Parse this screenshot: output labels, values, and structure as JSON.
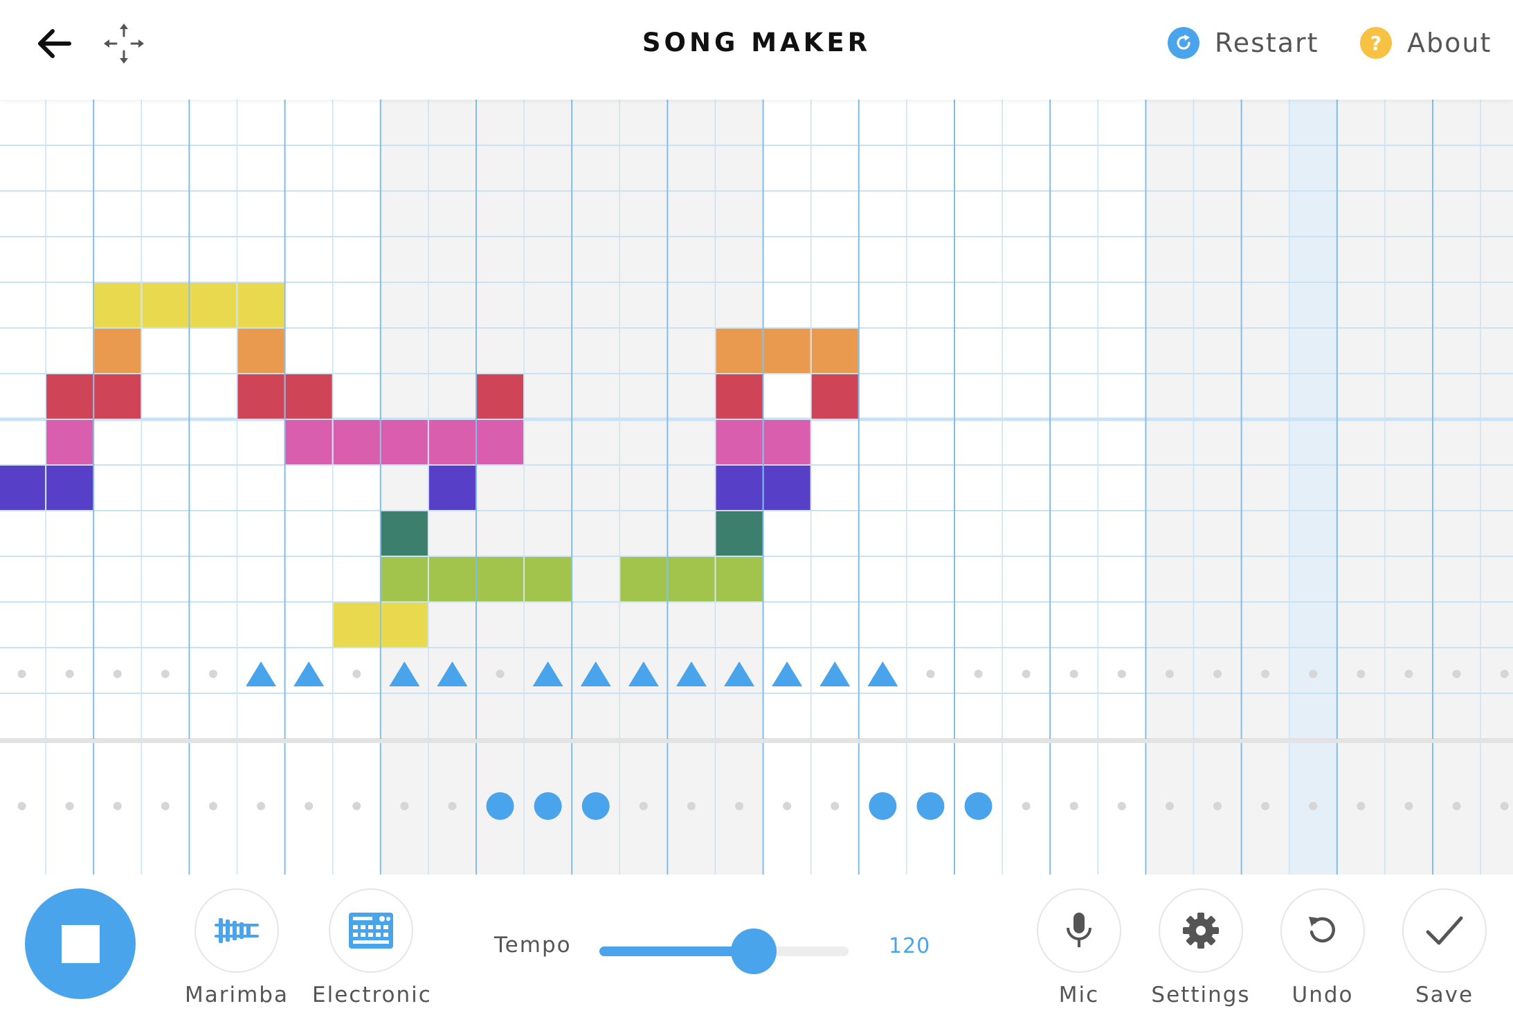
{
  "header": {
    "title": "SONG MAKER",
    "restart_label": "Restart",
    "about_label": "About",
    "back_icon": "arrow-left-icon",
    "move_icon": "move-arrows-icon",
    "restart_icon": "refresh-icon",
    "about_icon": "question-icon",
    "about_glyph": "?"
  },
  "colors": {
    "accent": "#4aa4eb",
    "restart_circle": "#4aa4eb",
    "about_circle": "#f7c244",
    "grid_line": "#c9e2f6",
    "bar_line": "#7fbdec",
    "shade": "#f3f3f3",
    "highlight_column": "#e4eff8",
    "note_palette": {
      "yellow": "#e8d94e",
      "orange": "#e99a4f",
      "red": "#d04458",
      "pink": "#d95fae",
      "purple": "#583fc7",
      "teal": "#3c7f6d",
      "green": "#a2c44c"
    }
  },
  "grid": {
    "columns": 32,
    "melody_rows": 14,
    "playhead_column": 27,
    "melody_notes": [
      {
        "col": 2,
        "row": 4,
        "color": "yellow"
      },
      {
        "col": 3,
        "row": 4,
        "color": "yellow"
      },
      {
        "col": 4,
        "row": 4,
        "color": "yellow"
      },
      {
        "col": 5,
        "row": 4,
        "color": "yellow"
      },
      {
        "col": 2,
        "row": 5,
        "color": "orange"
      },
      {
        "col": 5,
        "row": 5,
        "color": "orange"
      },
      {
        "col": 15,
        "row": 5,
        "color": "orange"
      },
      {
        "col": 16,
        "row": 5,
        "color": "orange"
      },
      {
        "col": 17,
        "row": 5,
        "color": "orange"
      },
      {
        "col": 1,
        "row": 6,
        "color": "red"
      },
      {
        "col": 2,
        "row": 6,
        "color": "red"
      },
      {
        "col": 5,
        "row": 6,
        "color": "red"
      },
      {
        "col": 6,
        "row": 6,
        "color": "red"
      },
      {
        "col": 10,
        "row": 6,
        "color": "red"
      },
      {
        "col": 15,
        "row": 6,
        "color": "red"
      },
      {
        "col": 17,
        "row": 6,
        "color": "red"
      },
      {
        "col": 1,
        "row": 7,
        "color": "pink"
      },
      {
        "col": 6,
        "row": 7,
        "color": "pink"
      },
      {
        "col": 7,
        "row": 7,
        "color": "pink"
      },
      {
        "col": 8,
        "row": 7,
        "color": "pink"
      },
      {
        "col": 9,
        "row": 7,
        "color": "pink"
      },
      {
        "col": 10,
        "row": 7,
        "color": "pink"
      },
      {
        "col": 15,
        "row": 7,
        "color": "pink"
      },
      {
        "col": 16,
        "row": 7,
        "color": "pink"
      },
      {
        "col": 0,
        "row": 8,
        "color": "purple"
      },
      {
        "col": 1,
        "row": 8,
        "color": "purple"
      },
      {
        "col": 9,
        "row": 8,
        "color": "purple"
      },
      {
        "col": 15,
        "row": 8,
        "color": "purple"
      },
      {
        "col": 16,
        "row": 8,
        "color": "purple"
      },
      {
        "col": 8,
        "row": 9,
        "color": "teal"
      },
      {
        "col": 15,
        "row": 9,
        "color": "teal"
      },
      {
        "col": 8,
        "row": 10,
        "color": "green"
      },
      {
        "col": 9,
        "row": 10,
        "color": "green"
      },
      {
        "col": 10,
        "row": 10,
        "color": "green"
      },
      {
        "col": 11,
        "row": 10,
        "color": "green"
      },
      {
        "col": 13,
        "row": 10,
        "color": "green"
      },
      {
        "col": 14,
        "row": 10,
        "color": "green"
      },
      {
        "col": 15,
        "row": 10,
        "color": "green"
      },
      {
        "col": 7,
        "row": 11,
        "color": "yellow"
      },
      {
        "col": 8,
        "row": 11,
        "color": "yellow"
      }
    ],
    "percussion_triangles": [
      5,
      6,
      8,
      9,
      11,
      12,
      13,
      14,
      15,
      16,
      17,
      18
    ],
    "percussion_circles": [
      10,
      11,
      12,
      18,
      19,
      20
    ]
  },
  "footer": {
    "play_icon": "stop-square-icon",
    "marimba_label": "Marimba",
    "marimba_icon": "marimba-icon",
    "electronic_label": "Electronic",
    "electronic_icon": "drum-machine-icon",
    "tempo_label": "Tempo",
    "tempo_value": "120",
    "tempo_fraction": 0.62,
    "mic_label": "Mic",
    "mic_icon": "microphone-icon",
    "settings_label": "Settings",
    "settings_icon": "gear-icon",
    "undo_label": "Undo",
    "undo_icon": "undo-icon",
    "save_label": "Save",
    "save_icon": "checkmark-icon"
  }
}
